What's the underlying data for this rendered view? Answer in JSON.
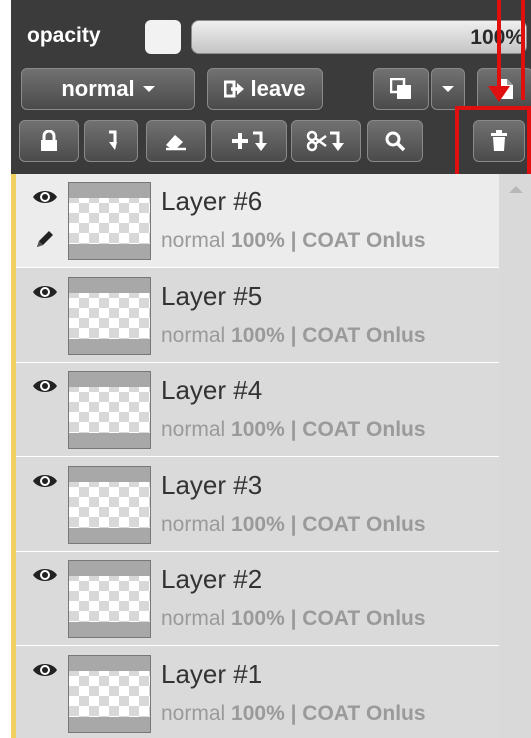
{
  "toolbar": {
    "opacity_label": "opacity",
    "opacity_value": "100%",
    "blend_mode": "normal",
    "leave_label": "leave"
  },
  "icons": {
    "duplicate": "duplicate-icon",
    "dropdown": "chevron-down-icon",
    "new_file": "new-file-icon",
    "lock": "lock-icon",
    "merge_down": "merge-down-icon",
    "eraser": "eraser-icon",
    "add_down": "add-merge-icon",
    "cut_down": "cut-merge-icon",
    "search": "search-icon",
    "delete": "trash-icon",
    "visibility": "eye-icon",
    "edit": "pencil-icon"
  },
  "colors": {
    "toolbar_bg": "#3b3b3b",
    "highlight": "#e01010",
    "active_stripe": "#f0d060"
  },
  "layers": [
    {
      "name": "Layer #6",
      "mode": "normal",
      "opacity": "100%",
      "owner": "COAT Onlus",
      "active": true
    },
    {
      "name": "Layer #5",
      "mode": "normal",
      "opacity": "100%",
      "owner": "COAT Onlus",
      "active": false
    },
    {
      "name": "Layer #4",
      "mode": "normal",
      "opacity": "100%",
      "owner": "COAT Onlus",
      "active": false
    },
    {
      "name": "Layer #3",
      "mode": "normal",
      "opacity": "100%",
      "owner": "COAT Onlus",
      "active": false
    },
    {
      "name": "Layer #2",
      "mode": "normal",
      "opacity": "100%",
      "owner": "COAT Onlus",
      "active": false
    },
    {
      "name": "Layer #1",
      "mode": "normal",
      "opacity": "100%",
      "owner": "COAT Onlus",
      "active": false
    }
  ]
}
